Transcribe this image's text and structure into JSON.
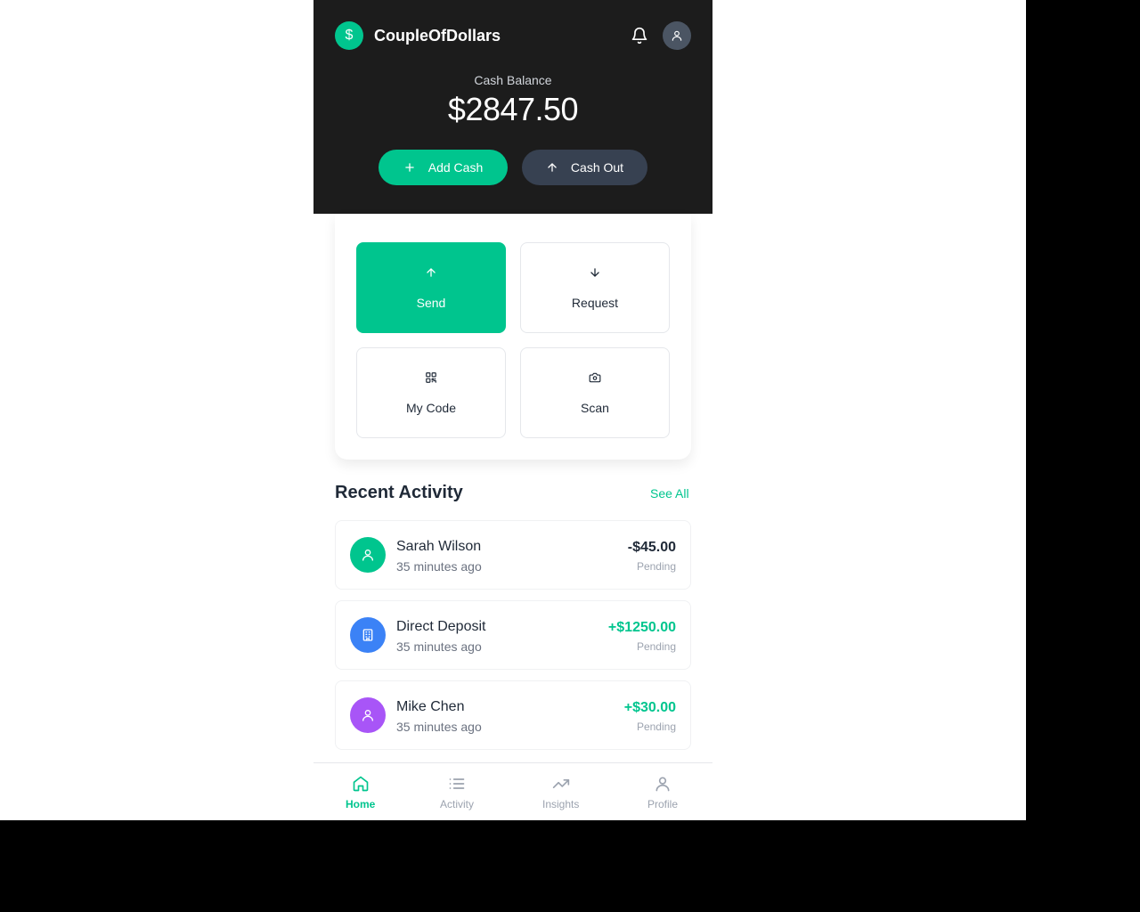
{
  "app": {
    "name": "CoupleOfDollars",
    "logo_symbol": "$",
    "accent_color": "#00c58e",
    "header_bg": "#1c1c1c"
  },
  "header": {
    "notifications_icon": "bell-icon",
    "profile_icon": "user-icon"
  },
  "balance": {
    "label": "Cash Balance",
    "value": "$2847.50"
  },
  "cash_buttons": {
    "add_label": "Add Cash",
    "out_label": "Cash Out"
  },
  "quick_actions": [
    {
      "label": "Send",
      "icon": "arrow-up-icon"
    },
    {
      "label": "Request",
      "icon": "arrow-down-icon"
    },
    {
      "label": "My Code",
      "icon": "qr-code-icon"
    },
    {
      "label": "Scan",
      "icon": "camera-icon"
    }
  ],
  "recent_activity": {
    "title": "Recent Activity",
    "see_all_label": "See All",
    "items": [
      {
        "name": "Sarah Wilson",
        "time": "35 minutes ago",
        "amount": "-$45.00",
        "status": "Pending",
        "icon": "user-icon",
        "color": "#00c58e"
      },
      {
        "name": "Direct Deposit",
        "time": "35 minutes ago",
        "amount": "+$1250.00",
        "status": "Pending",
        "icon": "building-icon",
        "color": "#3b82f6"
      },
      {
        "name": "Mike Chen",
        "time": "35 minutes ago",
        "amount": "+$30.00",
        "status": "Pending",
        "icon": "user-icon",
        "color": "#a855f7"
      }
    ]
  },
  "bottom_nav": {
    "items": [
      {
        "label": "Home",
        "icon": "home-icon",
        "active": true
      },
      {
        "label": "Activity",
        "icon": "list-icon",
        "active": false
      },
      {
        "label": "Insights",
        "icon": "trending-up-icon",
        "active": false
      },
      {
        "label": "Profile",
        "icon": "user-icon",
        "active": false
      }
    ]
  }
}
